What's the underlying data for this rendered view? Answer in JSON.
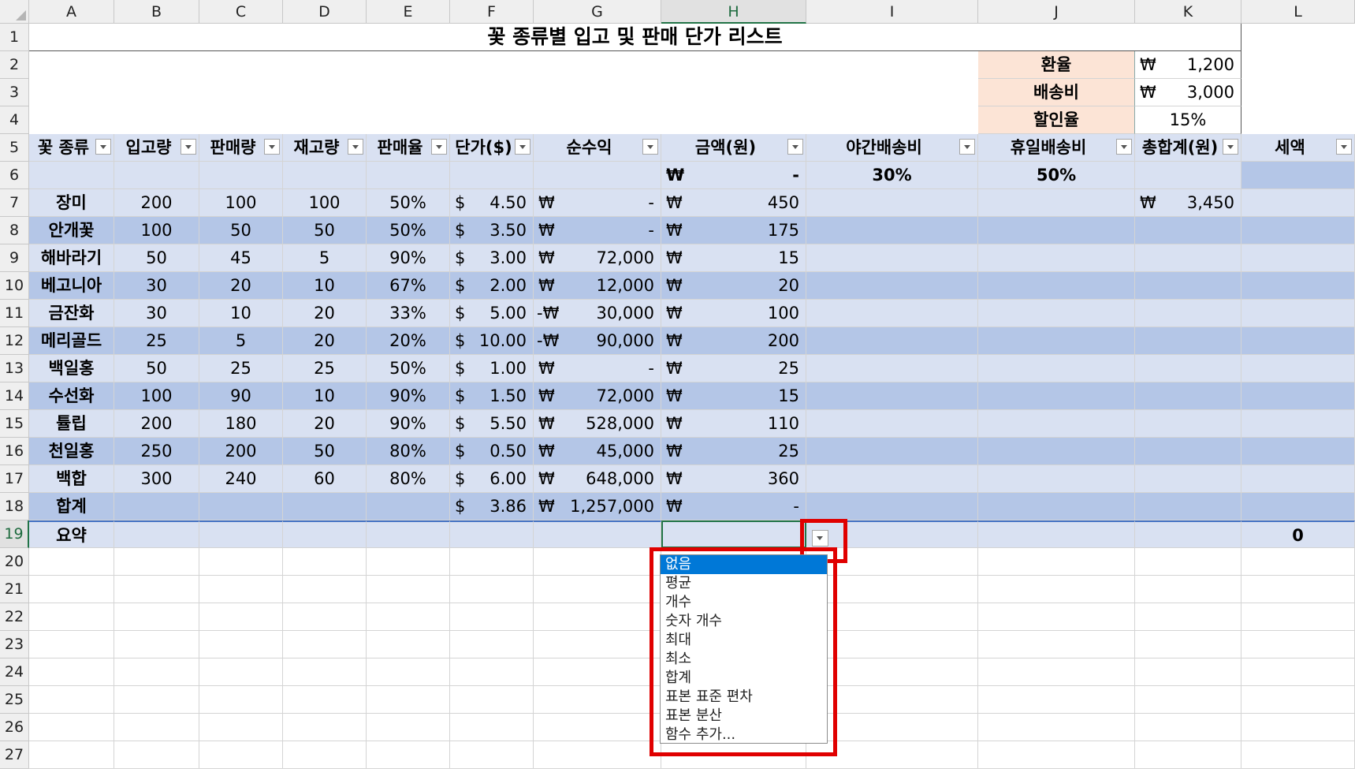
{
  "columns": [
    "A",
    "B",
    "C",
    "D",
    "E",
    "F",
    "G",
    "H",
    "I",
    "J",
    "K",
    "L"
  ],
  "selected_column": "H",
  "selected_row": "19",
  "rows": [
    "1",
    "2",
    "3",
    "4",
    "5",
    "6",
    "7",
    "8",
    "9",
    "10",
    "11",
    "12",
    "13",
    "14",
    "15",
    "16",
    "17",
    "18",
    "19",
    "20",
    "21",
    "22",
    "23",
    "24",
    "25",
    "26",
    "27"
  ],
  "title": "꽃 종류별 입고 및 판매 단가 리스트",
  "settings": [
    {
      "label": "환율",
      "currency": "₩",
      "value": "1,200"
    },
    {
      "label": "배송비",
      "currency": "₩",
      "value": "3,000"
    },
    {
      "label": "할인율",
      "currency": "",
      "value": "15%"
    }
  ],
  "headers": [
    "꽃 종류",
    "입고량",
    "판매량",
    "재고량",
    "판매율",
    "단가($)",
    "순수익",
    "금액(원)",
    "야간배송비",
    "휴일배송비",
    "총합계(원)",
    "세액"
  ],
  "row6": {
    "h_currency": "₩",
    "h_value": "-",
    "i": "30%",
    "j": "50%"
  },
  "data_rows": [
    {
      "name": "장미",
      "in": "200",
      "sold": "100",
      "stock": "100",
      "rate": "50%",
      "price": "4.50",
      "profit_sign": "",
      "profit": "-",
      "amount": "450",
      "total": "3,450"
    },
    {
      "name": "안개꽃",
      "in": "100",
      "sold": "50",
      "stock": "50",
      "rate": "50%",
      "price": "3.50",
      "profit_sign": "",
      "profit": "-",
      "amount": "175",
      "total": ""
    },
    {
      "name": "해바라기",
      "in": "50",
      "sold": "45",
      "stock": "5",
      "rate": "90%",
      "price": "3.00",
      "profit_sign": "",
      "profit": "72,000",
      "amount": "15",
      "total": ""
    },
    {
      "name": "베고니아",
      "in": "30",
      "sold": "20",
      "stock": "10",
      "rate": "67%",
      "price": "2.00",
      "profit_sign": "",
      "profit": "12,000",
      "amount": "20",
      "total": ""
    },
    {
      "name": "금잔화",
      "in": "30",
      "sold": "10",
      "stock": "20",
      "rate": "33%",
      "price": "5.00",
      "profit_sign": "-",
      "profit": "30,000",
      "amount": "100",
      "total": ""
    },
    {
      "name": "메리골드",
      "in": "25",
      "sold": "5",
      "stock": "20",
      "rate": "20%",
      "price": "10.00",
      "profit_sign": "-",
      "profit": "90,000",
      "amount": "200",
      "total": ""
    },
    {
      "name": "백일홍",
      "in": "50",
      "sold": "25",
      "stock": "25",
      "rate": "50%",
      "price": "1.00",
      "profit_sign": "",
      "profit": "-",
      "amount": "25",
      "total": ""
    },
    {
      "name": "수선화",
      "in": "100",
      "sold": "90",
      "stock": "10",
      "rate": "90%",
      "price": "1.50",
      "profit_sign": "",
      "profit": "72,000",
      "amount": "15",
      "total": ""
    },
    {
      "name": "튤립",
      "in": "200",
      "sold": "180",
      "stock": "20",
      "rate": "90%",
      "price": "5.50",
      "profit_sign": "",
      "profit": "528,000",
      "amount": "110",
      "total": ""
    },
    {
      "name": "천일홍",
      "in": "250",
      "sold": "200",
      "stock": "50",
      "rate": "80%",
      "price": "0.50",
      "profit_sign": "",
      "profit": "45,000",
      "amount": "25",
      "total": ""
    },
    {
      "name": "백합",
      "in": "300",
      "sold": "240",
      "stock": "60",
      "rate": "80%",
      "price": "6.00",
      "profit_sign": "",
      "profit": "648,000",
      "amount": "360",
      "total": ""
    }
  ],
  "sum_row": {
    "label": "합계",
    "price": "3.86",
    "profit": "1,257,000",
    "amount": "-"
  },
  "summary_row": {
    "label": "요약",
    "l_value": "0"
  },
  "symbols": {
    "dollar": "$",
    "won": "₩"
  },
  "dropdown_options": [
    "없음",
    "평균",
    "개수",
    "숫자 개수",
    "최대",
    "최소",
    "합계",
    "표본 표준 편차",
    "표본 분산",
    "함수 추가..."
  ],
  "dropdown_selected": 0,
  "colors": {
    "header_fill": "#d9e1f2",
    "band_light": "#d9e1f2",
    "band_dark": "#b4c6e7",
    "setting_fill": "#fce4d6",
    "highlight": "#e00000",
    "dropdown_selected": "#0078d7"
  }
}
